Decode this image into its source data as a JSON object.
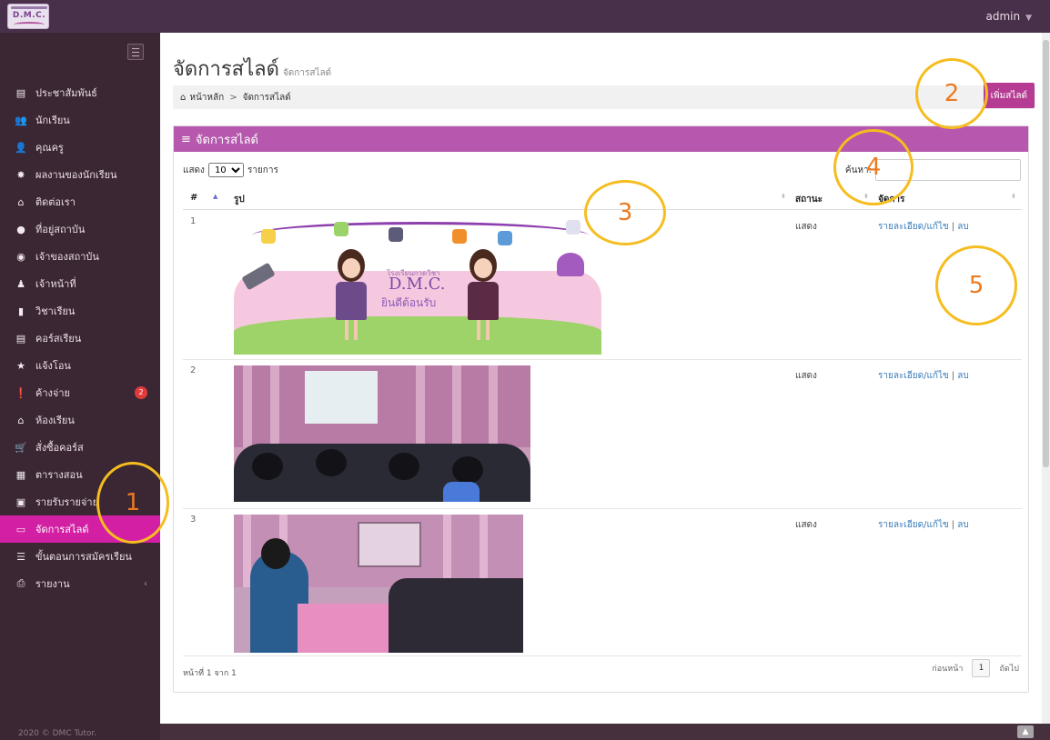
{
  "topbar": {
    "logo_text": "D.M.C.",
    "user": "admin"
  },
  "sidebar": {
    "items": [
      {
        "label": "ประชาสัมพันธ์",
        "icon": "newspaper-icon",
        "glyph": "▤"
      },
      {
        "label": "นักเรียน",
        "icon": "users-icon",
        "glyph": "👥"
      },
      {
        "label": "คุณครู",
        "icon": "user-icon",
        "glyph": "👤"
      },
      {
        "label": "ผลงานของนักเรียน",
        "icon": "award-icon",
        "glyph": "✸"
      },
      {
        "label": "ติดต่อเรา",
        "icon": "inbox-icon",
        "glyph": "⌂"
      },
      {
        "label": "ที่อยู่สถาบัน",
        "icon": "map-marker-icon",
        "glyph": "●"
      },
      {
        "label": "เจ้าของสถาบัน",
        "icon": "user-circle-icon",
        "glyph": "◉"
      },
      {
        "label": "เจ้าหน้าที่",
        "icon": "staff-icon",
        "glyph": "♟"
      },
      {
        "label": "วิชาเรียน",
        "icon": "file-icon",
        "glyph": "▮"
      },
      {
        "label": "คอร์สเรียน",
        "icon": "list-alt-icon",
        "glyph": "▤"
      },
      {
        "label": "แจ้งโอน",
        "icon": "star-icon",
        "glyph": "★"
      },
      {
        "label": "ค้างจ่าย",
        "icon": "exclamation-circle-icon",
        "glyph": "❗",
        "badge": "2"
      },
      {
        "label": "ห้องเรียน",
        "icon": "home-icon",
        "glyph": "⌂"
      },
      {
        "label": "สั่งซื้อคอร์ส",
        "icon": "cart-icon",
        "glyph": "🛒"
      },
      {
        "label": "ตารางสอน",
        "icon": "calendar-icon",
        "glyph": "▦"
      },
      {
        "label": "รายรับรายจ่าย",
        "icon": "money-icon",
        "glyph": "▣"
      },
      {
        "label": "จัดการสไลด์",
        "icon": "desktop-icon",
        "glyph": "▭",
        "active": true
      },
      {
        "label": "ขั้นตอนการสมัครเรียน",
        "icon": "table-icon",
        "glyph": "☰"
      },
      {
        "label": "รายงาน",
        "icon": "print-icon",
        "glyph": "⎙",
        "arrow": "‹"
      }
    ],
    "copyright": "2020 © DMC Tutor."
  },
  "page": {
    "title": "จัดการสไลด์",
    "subtitle": "จัดการสไลด์",
    "breadcrumb": {
      "home": "หน้าหลัก",
      "sep": ">",
      "current": "จัดการสไลด์"
    },
    "add_button": "เพิ่มสไลด์"
  },
  "panel": {
    "title": "จัดการสไลด์",
    "length_prefix": "แสดง",
    "length_value": "10",
    "length_suffix": "รายการ",
    "search_label": "ค้นหา:",
    "columns": {
      "num": "#",
      "image": "รูป",
      "status": "สถานะ",
      "manage": "จัดการ"
    },
    "rows": [
      {
        "num": "1",
        "status": "แสดง",
        "edit": "รายละเอียด/แก้ไข",
        "delete": "ลบ",
        "banner_line1": "โรงเรียนกวดวิชา",
        "banner_line2": "D.M.C.",
        "banner_line3": "ยินดีต้อนรับ"
      },
      {
        "num": "2",
        "status": "แสดง",
        "edit": "รายละเอียด/แก้ไข",
        "delete": "ลบ"
      },
      {
        "num": "3",
        "status": "แสดง",
        "edit": "รายละเอียด/แก้ไข",
        "delete": "ลบ"
      }
    ],
    "info": "หน้าที่ 1 จาก 1",
    "pager": {
      "prev": "ก่อนหน้า",
      "page": "1",
      "next": "ถัดไป"
    }
  },
  "annotations": [
    "1",
    "2",
    "3",
    "4",
    "5"
  ],
  "colors": {
    "sidebar_active": "#d21fa3",
    "panel_header": "#b658ad",
    "annotation": "#f5bd1f"
  }
}
